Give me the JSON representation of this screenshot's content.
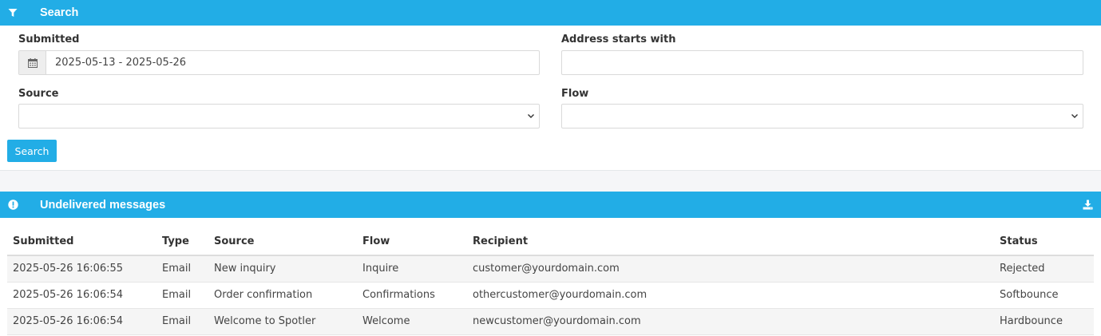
{
  "search_panel": {
    "title": "Search",
    "icon": "filter-icon",
    "submitted": {
      "label": "Submitted",
      "value": "2025-05-13 - 2025-05-26",
      "icon": "calendar-icon"
    },
    "address": {
      "label": "Address starts with",
      "value": ""
    },
    "source": {
      "label": "Source",
      "value": ""
    },
    "flow": {
      "label": "Flow",
      "value": ""
    },
    "search_button": "Search"
  },
  "results_panel": {
    "title": "Undelivered messages",
    "icon": "info-circle-icon",
    "download_icon": "download-icon",
    "columns": [
      "Submitted",
      "Type",
      "Source",
      "Flow",
      "Recipient",
      "Status"
    ],
    "rows": [
      [
        "2025-05-26 16:06:55",
        "Email",
        "New inquiry",
        "Inquire",
        "customer@yourdomain.com",
        "Rejected"
      ],
      [
        "2025-05-26 16:06:54",
        "Email",
        "Order confirmation",
        "Confirmations",
        "othercustomer@yourdomain.com",
        "Softbounce"
      ],
      [
        "2025-05-26 16:06:54",
        "Email",
        "Welcome to Spotler",
        "Welcome",
        "newcustomer@yourdomain.com",
        "Hardbounce"
      ]
    ]
  },
  "colors": {
    "accent": "#22ade6",
    "band": "#f5f6f8",
    "row_alt": "#f5f5f5"
  }
}
